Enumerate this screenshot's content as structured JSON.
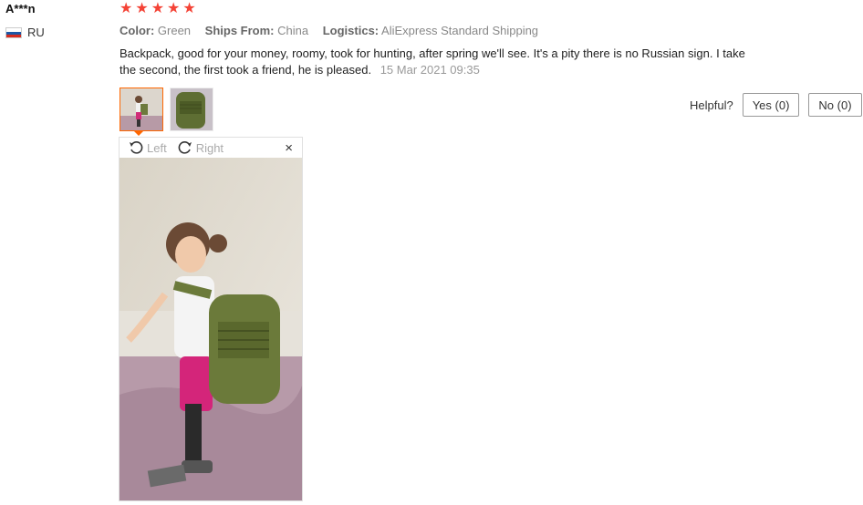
{
  "buyer": {
    "name": "A***n",
    "country": "RU",
    "flag_icon": "russia-flag-icon"
  },
  "rating": {
    "stars": 5,
    "max": 5,
    "color": "#f44336"
  },
  "meta": {
    "color_label": "Color:",
    "color_value": "Green",
    "ships_label": "Ships From:",
    "ships_value": "China",
    "logistics_label": "Logistics:",
    "logistics_value": "AliExpress Standard Shipping"
  },
  "review": {
    "text": "Backpack, good for your money, roomy, took for hunting, after spring we'll see. It's a pity there is no Russian sign. I take the second, the first took a friend, he is pleased.",
    "date": "15 Mar 2021 09:35"
  },
  "helpful": {
    "label": "Helpful?",
    "yes_label": "Yes (0)",
    "no_label": "No (0)"
  },
  "viewer": {
    "rotate_left_label": "Left",
    "rotate_right_label": "Right",
    "close_symbol": "×"
  },
  "colors": {
    "accent": "#ff6600",
    "star": "#f44336",
    "muted_text": "#999999"
  }
}
